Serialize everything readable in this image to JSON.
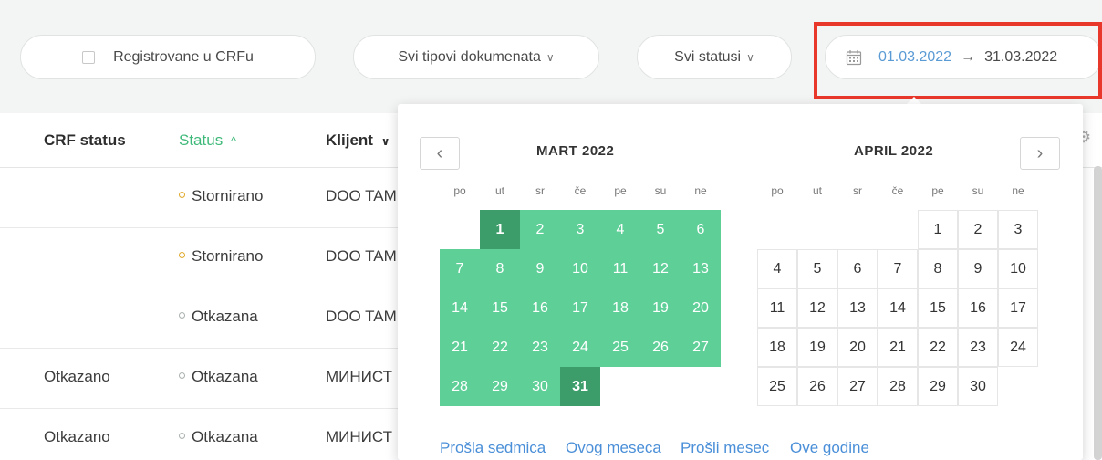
{
  "filters": {
    "registered_label": "Registrovane u CRFu",
    "doc_types_label": "Svi tipovi dokumenata",
    "statuses_label": "Svi statusi",
    "date_from": "01.03.2022",
    "date_arrow": "→",
    "date_to": "31.03.2022",
    "chevron": "∨"
  },
  "table": {
    "headers": {
      "crf_status": "CRF status",
      "status": "Status",
      "status_sort": "^",
      "client": "Klijent",
      "client_sort": "∨"
    },
    "rows": [
      {
        "crf": "",
        "status": "Stornirano",
        "client": "DOO TAM"
      },
      {
        "crf": "",
        "status": "Stornirano",
        "client": "DOO TAM"
      },
      {
        "crf": "",
        "status": "Otkazana",
        "client": "DOO TAM"
      },
      {
        "crf": "Otkazano",
        "status": "Otkazana",
        "client": "МИНИСТ"
      },
      {
        "crf": "Otkazano",
        "status": "Otkazana",
        "client": "МИНИСТ"
      }
    ]
  },
  "calendar": {
    "left_month": "MART 2022",
    "right_month": "APRIL 2022",
    "weekdays": [
      "po",
      "ut",
      "sr",
      "če",
      "pe",
      "su",
      "ne"
    ],
    "prev_icon": "‹",
    "next_icon": "›",
    "quick_links": [
      "Prošla sedmica",
      "Ovog meseca",
      "Prošli mesec",
      "Ove godine"
    ]
  },
  "colors": {
    "accent_green": "#5fcf98",
    "edge_green": "#3c9d6a",
    "link_blue": "#4a8fd8",
    "highlight_red": "#e8382b"
  }
}
